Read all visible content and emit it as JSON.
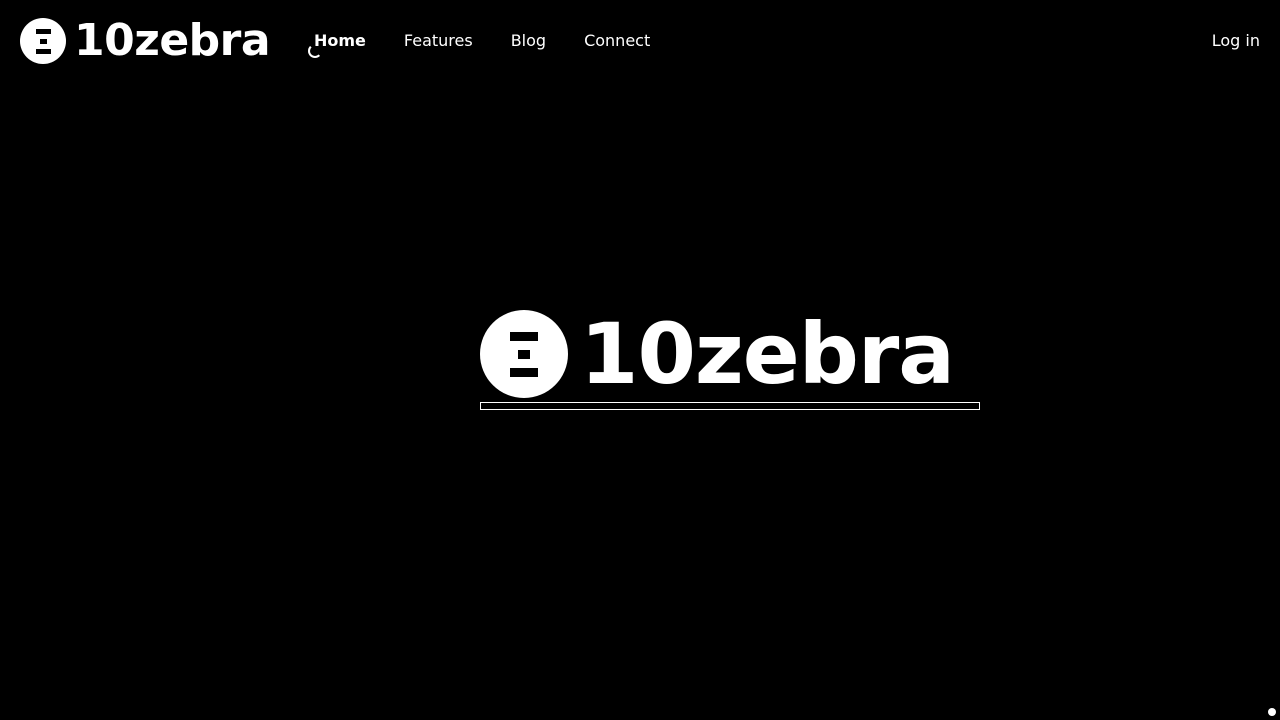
{
  "header": {
    "brand_name": "10zebra",
    "nav": [
      {
        "label": "Home",
        "active": true
      },
      {
        "label": "Features",
        "active": false
      },
      {
        "label": "Blog",
        "active": false
      },
      {
        "label": "Connect",
        "active": false
      }
    ],
    "login_label": "Log in"
  },
  "hero": {
    "brand_name": "10zebra",
    "loading_progress": 0
  },
  "colors": {
    "background": "#000000",
    "foreground": "#ffffff"
  },
  "icons": {
    "logo": "zebra-logo-icon",
    "loading": "loading-spinner-icon"
  }
}
